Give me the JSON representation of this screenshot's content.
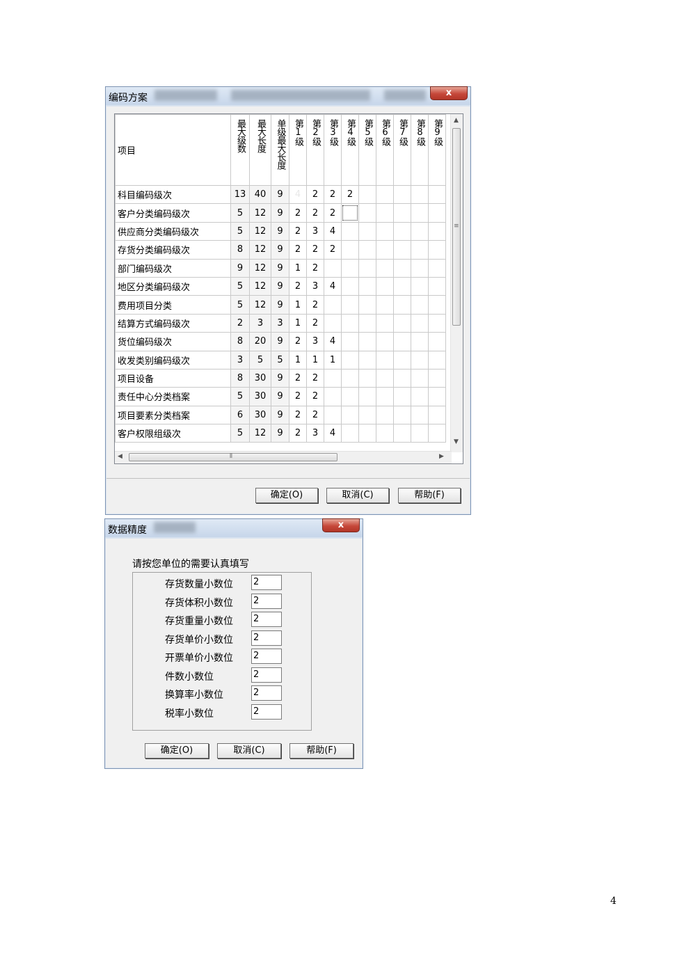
{
  "coding_window": {
    "title": "编码方案",
    "close_label": "x",
    "columns": [
      "项目",
      "最大级数",
      "最大长度",
      "单级最大长度",
      "第1级",
      "第2级",
      "第3级",
      "第4级",
      "第5级",
      "第6级",
      "第7级",
      "第8级",
      "第9级"
    ],
    "rows": [
      [
        "科目编码级次",
        "13",
        "40",
        "9",
        "4",
        "2",
        "2",
        "2",
        "",
        "",
        "",
        "",
        ""
      ],
      [
        "客户分类编码级次",
        "5",
        "12",
        "9",
        "2",
        "2",
        "2",
        "",
        "",
        "",
        "",
        "",
        ""
      ],
      [
        "供应商分类编码级次",
        "5",
        "12",
        "9",
        "2",
        "3",
        "4",
        "",
        "",
        "",
        "",
        "",
        ""
      ],
      [
        "存货分类编码级次",
        "8",
        "12",
        "9",
        "2",
        "2",
        "2",
        "",
        "",
        "",
        "",
        "",
        ""
      ],
      [
        "部门编码级次",
        "9",
        "12",
        "9",
        "1",
        "2",
        "",
        "",
        "",
        "",
        "",
        "",
        ""
      ],
      [
        "地区分类编码级次",
        "5",
        "12",
        "9",
        "2",
        "3",
        "4",
        "",
        "",
        "",
        "",
        "",
        ""
      ],
      [
        "费用项目分类",
        "5",
        "12",
        "9",
        "1",
        "2",
        "",
        "",
        "",
        "",
        "",
        "",
        ""
      ],
      [
        "结算方式编码级次",
        "2",
        "3",
        "3",
        "1",
        "2",
        "",
        "",
        "",
        "",
        "",
        "",
        ""
      ],
      [
        "货位编码级次",
        "8",
        "20",
        "9",
        "2",
        "3",
        "4",
        "",
        "",
        "",
        "",
        "",
        ""
      ],
      [
        "收发类别编码级次",
        "3",
        "5",
        "5",
        "1",
        "1",
        "1",
        "",
        "",
        "",
        "",
        "",
        ""
      ],
      [
        "项目设备",
        "8",
        "30",
        "9",
        "2",
        "2",
        "",
        "",
        "",
        "",
        "",
        "",
        ""
      ],
      [
        "责任中心分类档案",
        "5",
        "30",
        "9",
        "2",
        "2",
        "",
        "",
        "",
        "",
        "",
        "",
        ""
      ],
      [
        "项目要素分类档案",
        "6",
        "30",
        "9",
        "2",
        "2",
        "",
        "",
        "",
        "",
        "",
        "",
        ""
      ],
      [
        "客户权限组级次",
        "5",
        "12",
        "9",
        "2",
        "3",
        "4",
        "",
        "",
        "",
        "",
        "",
        ""
      ]
    ],
    "buttons": {
      "ok": "确定(O)",
      "cancel": "取消(C)",
      "help": "帮助(F)"
    }
  },
  "precision_window": {
    "title": "数据精度",
    "close_label": "x",
    "prompt": "请按您单位的需要认真填写",
    "fields": [
      {
        "label": "存货数量小数位",
        "value": "2"
      },
      {
        "label": "存货体积小数位",
        "value": "2"
      },
      {
        "label": "存货重量小数位",
        "value": "2"
      },
      {
        "label": "存货单价小数位",
        "value": "2"
      },
      {
        "label": "开票单价小数位",
        "value": "2"
      },
      {
        "label": "件数小数位",
        "value": "2"
      },
      {
        "label": "换算率小数位",
        "value": "2"
      },
      {
        "label": "税率小数位",
        "value": "2"
      }
    ],
    "buttons": {
      "ok": "确定(O)",
      "cancel": "取消(C)",
      "help": "帮助(F)"
    }
  },
  "page_number": "4"
}
